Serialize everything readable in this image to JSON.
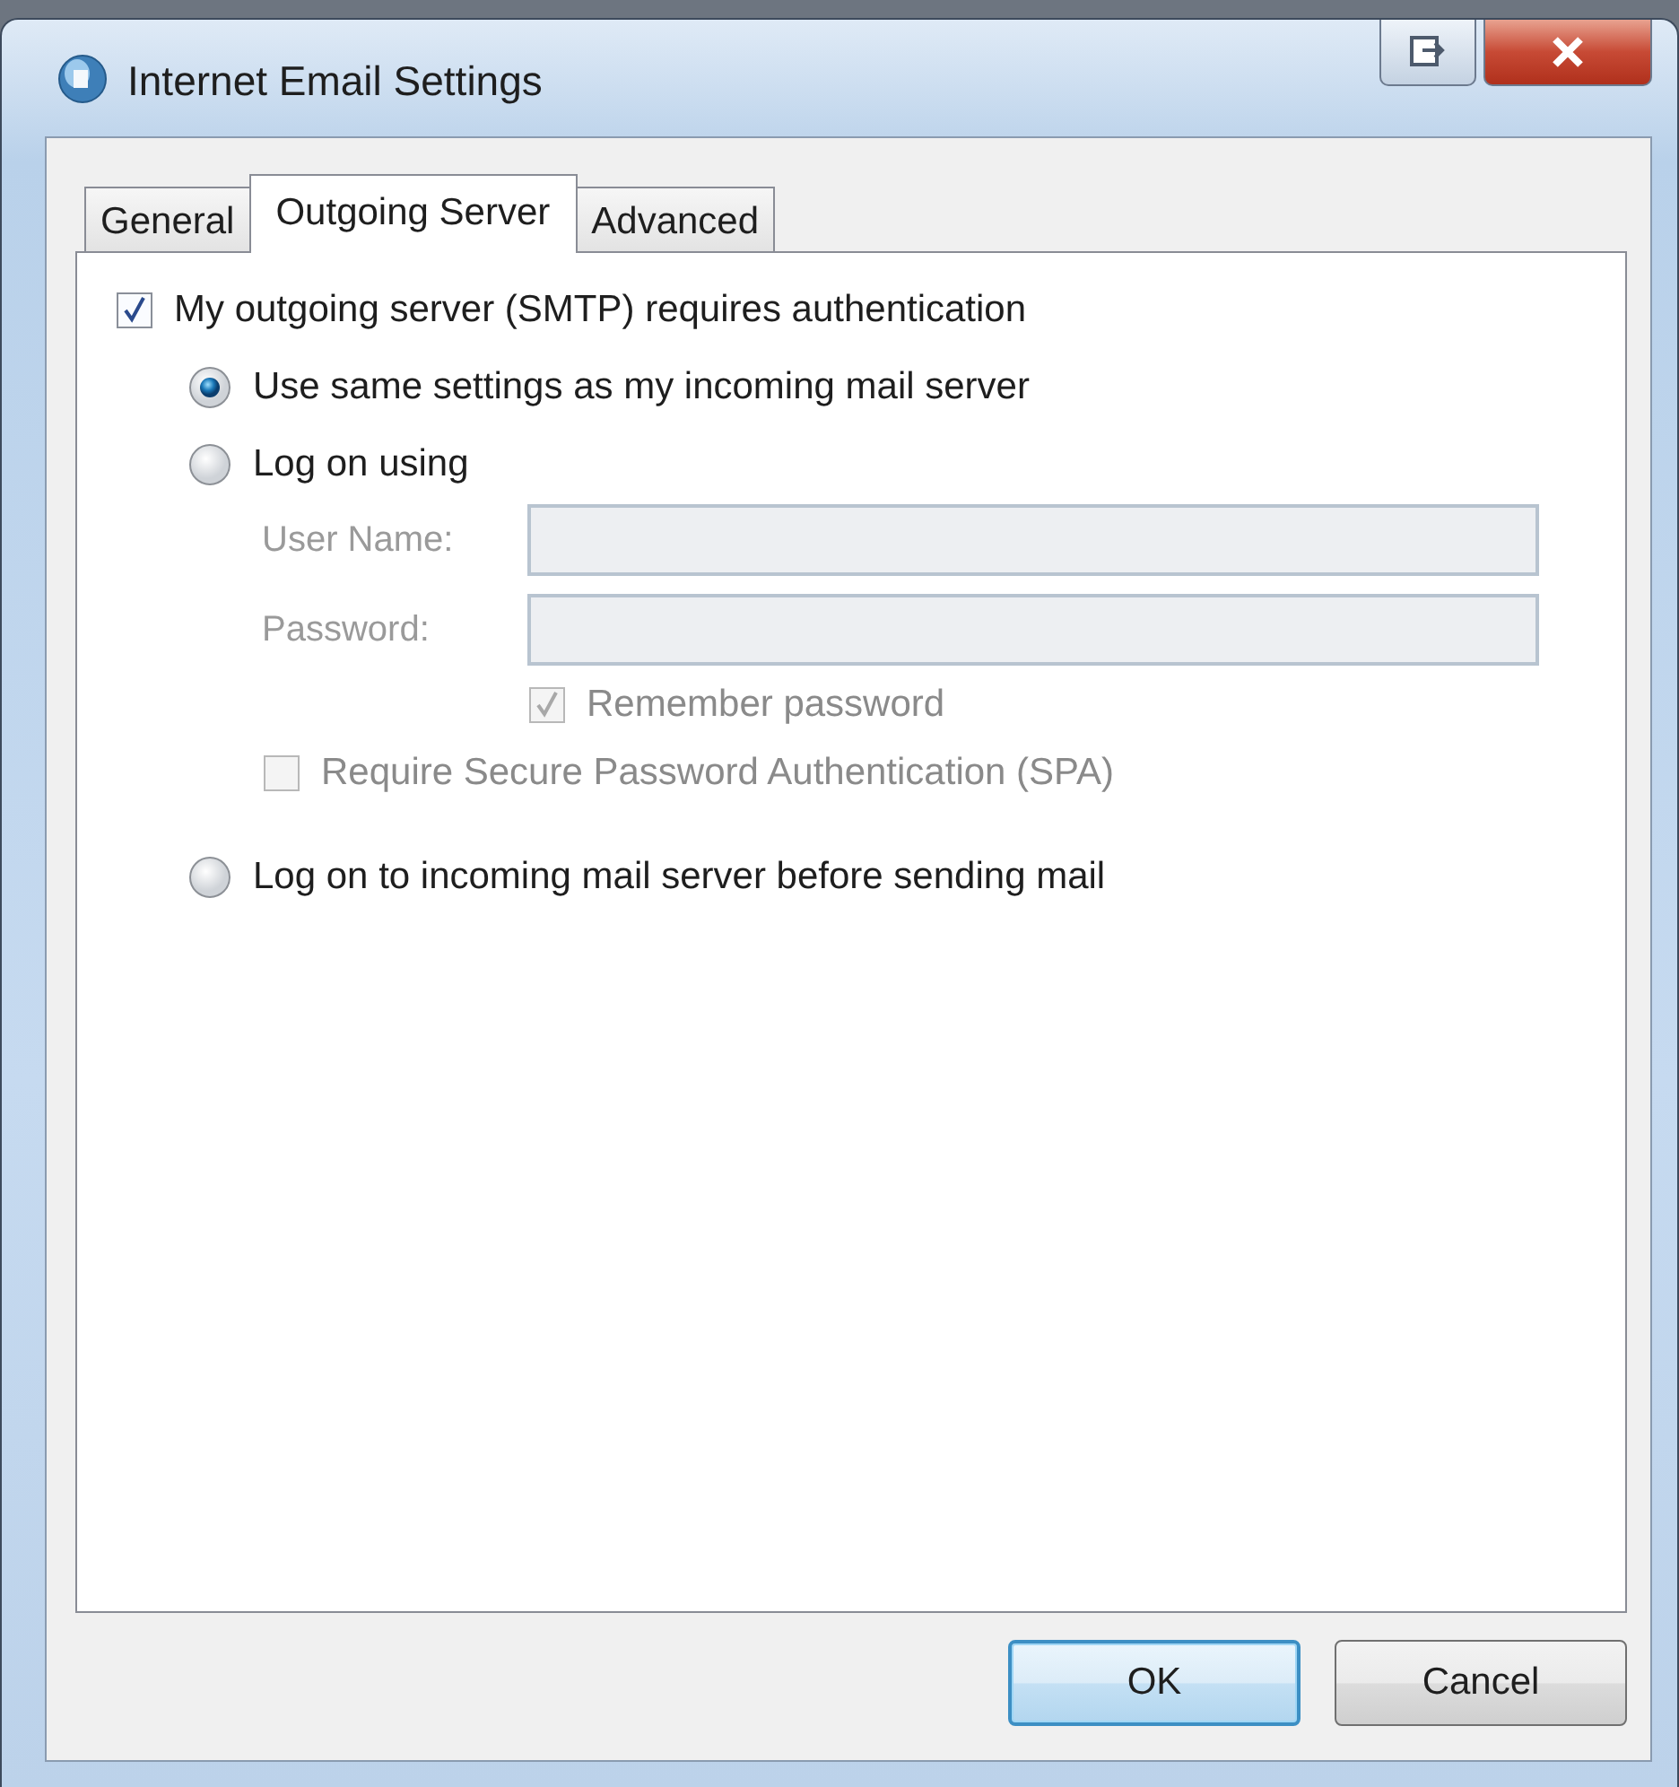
{
  "window": {
    "title": "Internet Email Settings"
  },
  "tabs": [
    {
      "label": "General",
      "selected": false
    },
    {
      "label": "Outgoing Server",
      "selected": true
    },
    {
      "label": "Advanced",
      "selected": false
    }
  ],
  "auth_checkbox": {
    "label": "My outgoing server (SMTP) requires authentication",
    "checked": true
  },
  "auth_options": [
    {
      "label": "Use same settings as my incoming mail server",
      "selected": true
    },
    {
      "label": "Log on using",
      "selected": false
    },
    {
      "label": "Log on to incoming mail server before sending mail",
      "selected": false
    }
  ],
  "logon_fields": [
    {
      "label": "User Name:",
      "disabled": true
    },
    {
      "label": "Password:",
      "disabled": true
    }
  ],
  "remember_password": {
    "label": "Remember password",
    "checked": true,
    "disabled": true
  },
  "require_spa": {
    "label": "Require Secure Password Authentication (SPA)",
    "checked": false,
    "disabled": true
  },
  "buttons": [
    {
      "label": "OK",
      "default": true
    },
    {
      "label": "Cancel",
      "default": false
    }
  ]
}
